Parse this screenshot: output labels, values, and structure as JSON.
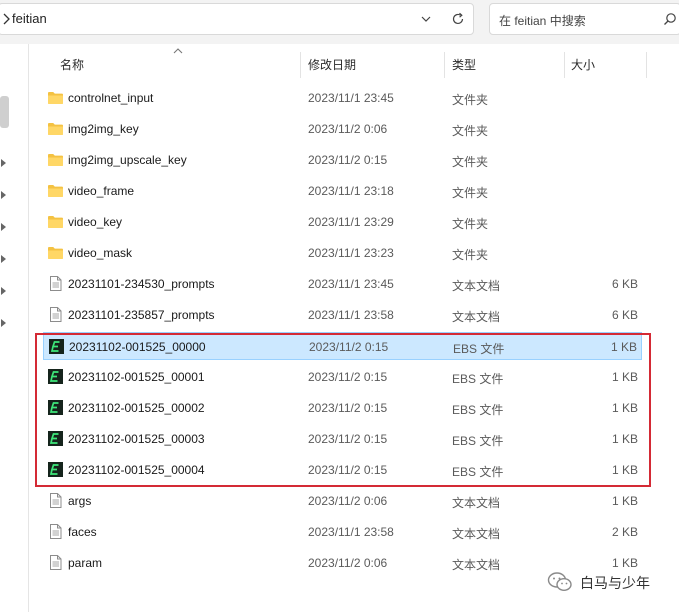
{
  "address_bar": {
    "path": "feitian"
  },
  "search": {
    "placeholder": "在 feitian 中搜索"
  },
  "columns": {
    "name": "名称",
    "date": "修改日期",
    "type": "类型",
    "size": "大小"
  },
  "files": [
    {
      "name": "controlnet_input",
      "date": "2023/11/1 23:45",
      "type": "文件夹",
      "size": "",
      "icon": "folder-icon"
    },
    {
      "name": "img2img_key",
      "date": "2023/11/2 0:06",
      "type": "文件夹",
      "size": "",
      "icon": "folder-icon"
    },
    {
      "name": "img2img_upscale_key",
      "date": "2023/11/2 0:15",
      "type": "文件夹",
      "size": "",
      "icon": "folder-icon"
    },
    {
      "name": "video_frame",
      "date": "2023/11/1 23:18",
      "type": "文件夹",
      "size": "",
      "icon": "folder-icon"
    },
    {
      "name": "video_key",
      "date": "2023/11/1 23:29",
      "type": "文件夹",
      "size": "",
      "icon": "folder-icon"
    },
    {
      "name": "video_mask",
      "date": "2023/11/1 23:23",
      "type": "文件夹",
      "size": "",
      "icon": "folder-icon"
    },
    {
      "name": "20231101-234530_prompts",
      "date": "2023/11/1 23:45",
      "type": "文本文档",
      "size": "6 KB",
      "icon": "text-file-icon"
    },
    {
      "name": "20231101-235857_prompts",
      "date": "2023/11/1 23:58",
      "type": "文本文档",
      "size": "6 KB",
      "icon": "text-file-icon"
    },
    {
      "name": "20231102-001525_00000",
      "date": "2023/11/2 0:15",
      "type": "EBS 文件",
      "size": "1 KB",
      "icon": "ebs-file-icon",
      "selected": true
    },
    {
      "name": "20231102-001525_00001",
      "date": "2023/11/2 0:15",
      "type": "EBS 文件",
      "size": "1 KB",
      "icon": "ebs-file-icon"
    },
    {
      "name": "20231102-001525_00002",
      "date": "2023/11/2 0:15",
      "type": "EBS 文件",
      "size": "1 KB",
      "icon": "ebs-file-icon"
    },
    {
      "name": "20231102-001525_00003",
      "date": "2023/11/2 0:15",
      "type": "EBS 文件",
      "size": "1 KB",
      "icon": "ebs-file-icon"
    },
    {
      "name": "20231102-001525_00004",
      "date": "2023/11/2 0:15",
      "type": "EBS 文件",
      "size": "1 KB",
      "icon": "ebs-file-icon"
    },
    {
      "name": "args",
      "date": "2023/11/2 0:06",
      "type": "文本文档",
      "size": "1 KB",
      "icon": "text-file-icon"
    },
    {
      "name": "faces",
      "date": "2023/11/1 23:58",
      "type": "文本文档",
      "size": "2 KB",
      "icon": "text-file-icon"
    },
    {
      "name": "param",
      "date": "2023/11/2 0:06",
      "type": "文本文档",
      "size": "1 KB",
      "icon": "text-file-icon"
    }
  ],
  "watermark": {
    "text": "白马与少年"
  },
  "colors": {
    "selection": "#cce8ff",
    "highlight_box": "#d42a35",
    "folder": "#f4c242"
  }
}
